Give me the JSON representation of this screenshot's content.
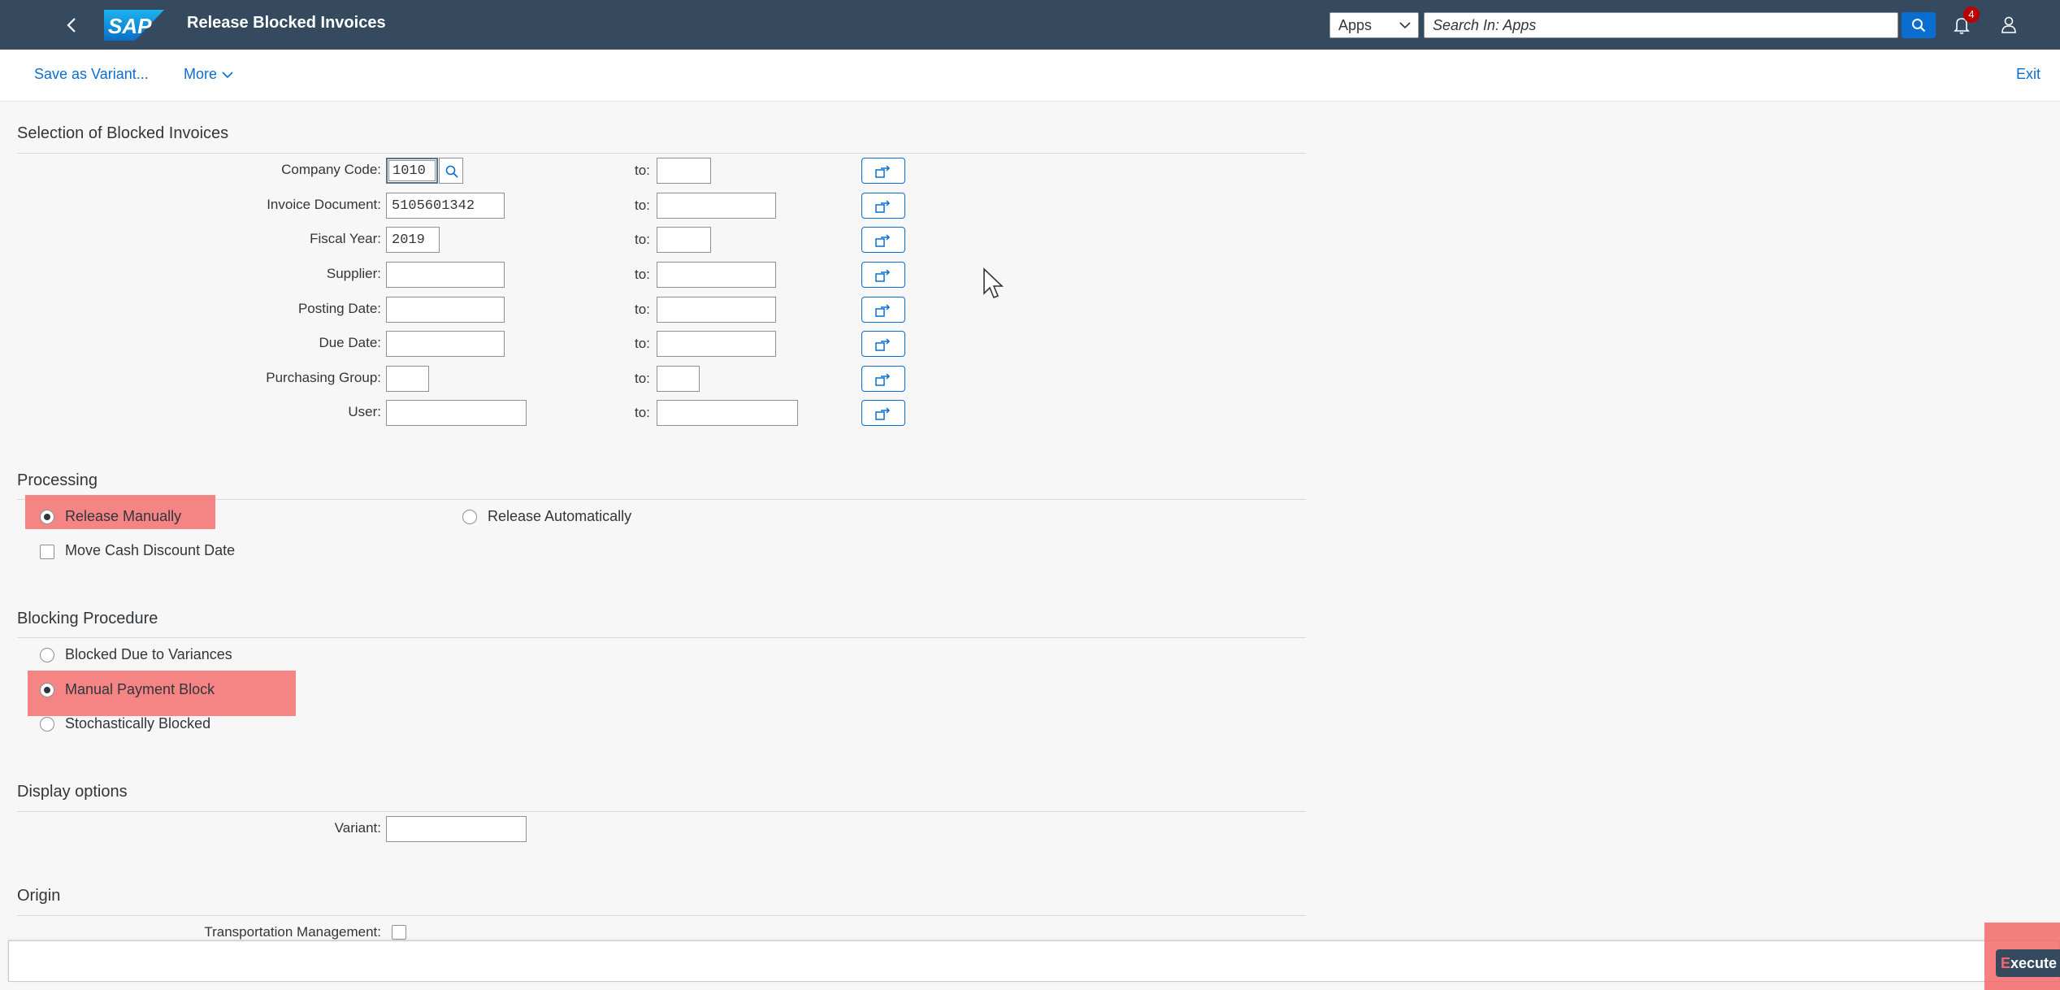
{
  "shell": {
    "logo_text": "SAP",
    "title": "Release Blocked Invoices",
    "apps_label": "Apps",
    "search_placeholder": "Search In: Apps",
    "notification_count": "4"
  },
  "toolbar": {
    "save_variant": "Save as Variant...",
    "more": "More",
    "exit": "Exit"
  },
  "selection": {
    "title": "Selection of Blocked Invoices",
    "to_label": "to:",
    "fields": [
      {
        "label": "Company Code:",
        "value": ""
      },
      {
        "label": "Invoice Document:",
        "value": "5105601342"
      },
      {
        "label": "Fiscal Year:",
        "value": "2019"
      },
      {
        "label": "Supplier:",
        "value": ""
      },
      {
        "label": "Posting Date:",
        "value": ""
      },
      {
        "label": "Due Date:",
        "value": ""
      },
      {
        "label": "Purchasing Group:",
        "value": ""
      },
      {
        "label": "User:",
        "value": ""
      }
    ],
    "company_code_value": "1010"
  },
  "processing": {
    "title": "Processing",
    "release_manually": "Release Manually",
    "release_automatically": "Release Automatically",
    "move_cash_discount": "Move Cash Discount Date"
  },
  "blocking": {
    "title": "Blocking Procedure",
    "variances": "Blocked Due to Variances",
    "manual": "Manual Payment Block",
    "stochastic": "Stochastically Blocked"
  },
  "display": {
    "title": "Display options",
    "variant_label": "Variant:",
    "variant_value": ""
  },
  "origin": {
    "title": "Origin",
    "tm_label": "Transportation Management:"
  },
  "footer": {
    "execute_prefix": "E",
    "execute_rest": "xecute"
  }
}
